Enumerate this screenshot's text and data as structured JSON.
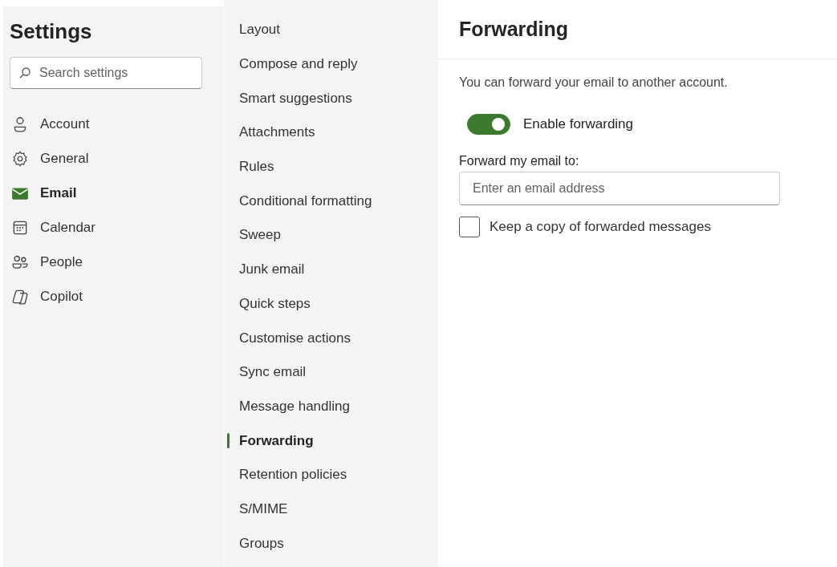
{
  "sidebar": {
    "title": "Settings",
    "search": {
      "placeholder": "Search settings"
    },
    "items": [
      {
        "label": "Account",
        "kind": "person",
        "selected": false
      },
      {
        "label": "General",
        "kind": "gear",
        "selected": false
      },
      {
        "label": "Email",
        "kind": "mail",
        "selected": true
      },
      {
        "label": "Calendar",
        "kind": "calendar",
        "selected": false
      },
      {
        "label": "People",
        "kind": "people",
        "selected": false
      },
      {
        "label": "Copilot",
        "kind": "copilot",
        "selected": false
      }
    ]
  },
  "subnav": {
    "items": [
      {
        "label": "Layout",
        "selected": false
      },
      {
        "label": "Compose and reply",
        "selected": false
      },
      {
        "label": "Smart suggestions",
        "selected": false
      },
      {
        "label": "Attachments",
        "selected": false
      },
      {
        "label": "Rules",
        "selected": false
      },
      {
        "label": "Conditional formatting",
        "selected": false
      },
      {
        "label": "Sweep",
        "selected": false
      },
      {
        "label": "Junk email",
        "selected": false
      },
      {
        "label": "Quick steps",
        "selected": false
      },
      {
        "label": "Customise actions",
        "selected": false
      },
      {
        "label": "Sync email",
        "selected": false
      },
      {
        "label": "Message handling",
        "selected": false
      },
      {
        "label": "Forwarding",
        "selected": true
      },
      {
        "label": "Retention policies",
        "selected": false
      },
      {
        "label": "S/MIME",
        "selected": false
      },
      {
        "label": "Groups",
        "selected": false
      }
    ]
  },
  "panel": {
    "title": "Forwarding",
    "description": "You can forward your email to another account.",
    "toggle": {
      "label": "Enable forwarding",
      "on": true
    },
    "field": {
      "label": "Forward my email to:",
      "placeholder": "Enter an email address"
    },
    "checkbox": {
      "label": "Keep a copy of forwarded messages",
      "checked": false
    }
  }
}
